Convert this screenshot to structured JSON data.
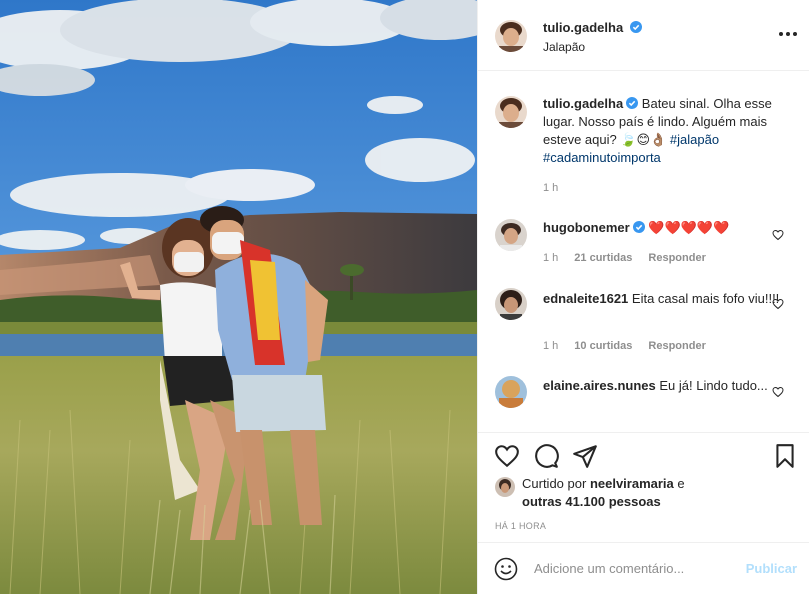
{
  "post": {
    "username": "tulio.gadelha",
    "location": "Jalapão"
  },
  "caption": {
    "username": "tulio.gadelha",
    "text": "Bateu sinal. Olha esse lugar. Nosso país é lindo. Alguém mais esteve aqui?",
    "emojis": "🍃😊👌🏽",
    "hashtag1": "#jalapão",
    "hashtag2": "#cadaminutoimporta",
    "time": "1 h"
  },
  "comments": [
    {
      "username": "hugobonemer",
      "text": "❤️❤️❤️❤️❤️",
      "time": "1 h",
      "likes": "21 curtidas",
      "reply": "Responder"
    },
    {
      "username": "ednaleite1621",
      "text": "Eita casal mais fofo viu!!!!",
      "time": "1 h",
      "likes": "10 curtidas",
      "reply": "Responder"
    },
    {
      "username": "elaine.aires.nunes",
      "text": "Eu já! Lindo tudo..."
    }
  ],
  "likes": {
    "prefix": "Curtido por",
    "user": "neelviramaria",
    "conj": "e",
    "others": "outras 41.100 pessoas"
  },
  "timestamp": "HÁ 1 HORA",
  "composer": {
    "placeholder": "Adicione um comentário...",
    "publish": "Publicar"
  },
  "colors": {
    "link": "#00376b",
    "verified": "#3897f0",
    "muted": "#8e8e8e",
    "publish_disabled": "#b2dffc"
  }
}
